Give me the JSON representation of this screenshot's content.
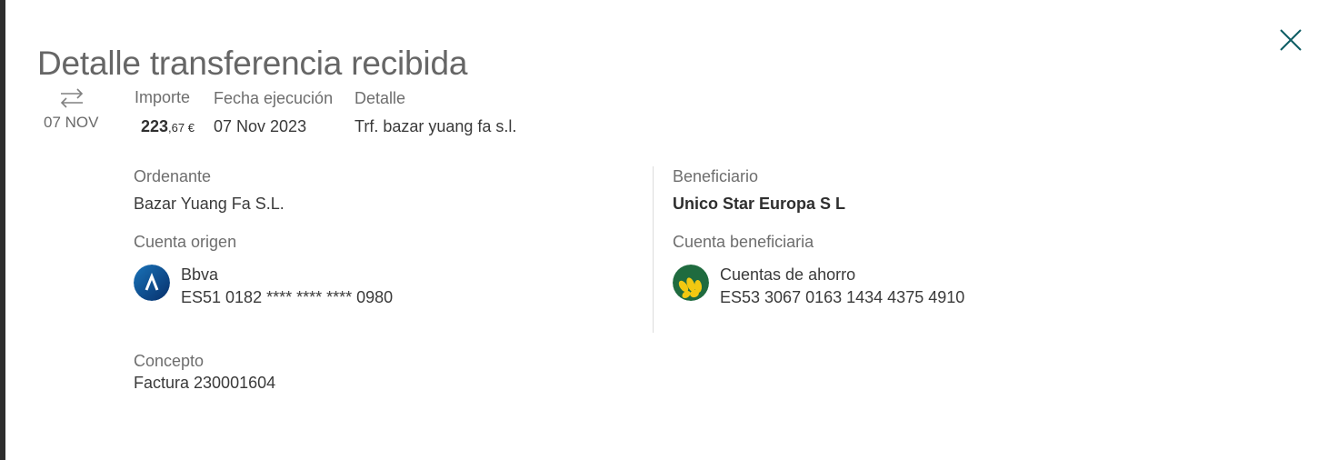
{
  "header": {
    "title": "Detalle transferencia recibida"
  },
  "summary": {
    "date_short": "07 NOV",
    "importe_label": "Importe",
    "importe_int": "223",
    "importe_dec": ",67 €",
    "fecha_label": "Fecha ejecución",
    "fecha_value": "07 Nov 2023",
    "detalle_label": "Detalle",
    "detalle_value": "Trf. bazar yuang fa s.l."
  },
  "ordenante": {
    "label": "Ordenante",
    "name": "Bazar Yuang Fa S.L.",
    "account_label": "Cuenta origen",
    "bank_name": "Bbva",
    "iban": "ES51 0182 **** **** **** 0980"
  },
  "beneficiario": {
    "label": "Beneficiario",
    "name": "Unico Star Europa S L",
    "account_label": "Cuenta beneficiaria",
    "bank_name": "Cuentas de ahorro",
    "iban": "ES53 3067 0163 1434 4375 4910"
  },
  "concepto": {
    "label": "Concepto",
    "value": "Factura 230001604"
  },
  "colors": {
    "accent": "#0d5c63",
    "bbva_blue": "#0b4a9a",
    "rural_green": "#1f6b3f",
    "rural_yellow": "#f2c811"
  },
  "icons": {
    "close": "close-icon",
    "transfer": "transfer-arrows-icon",
    "origin_bank": "bbva-logo-icon",
    "dest_bank": "caja-rural-logo-icon"
  }
}
